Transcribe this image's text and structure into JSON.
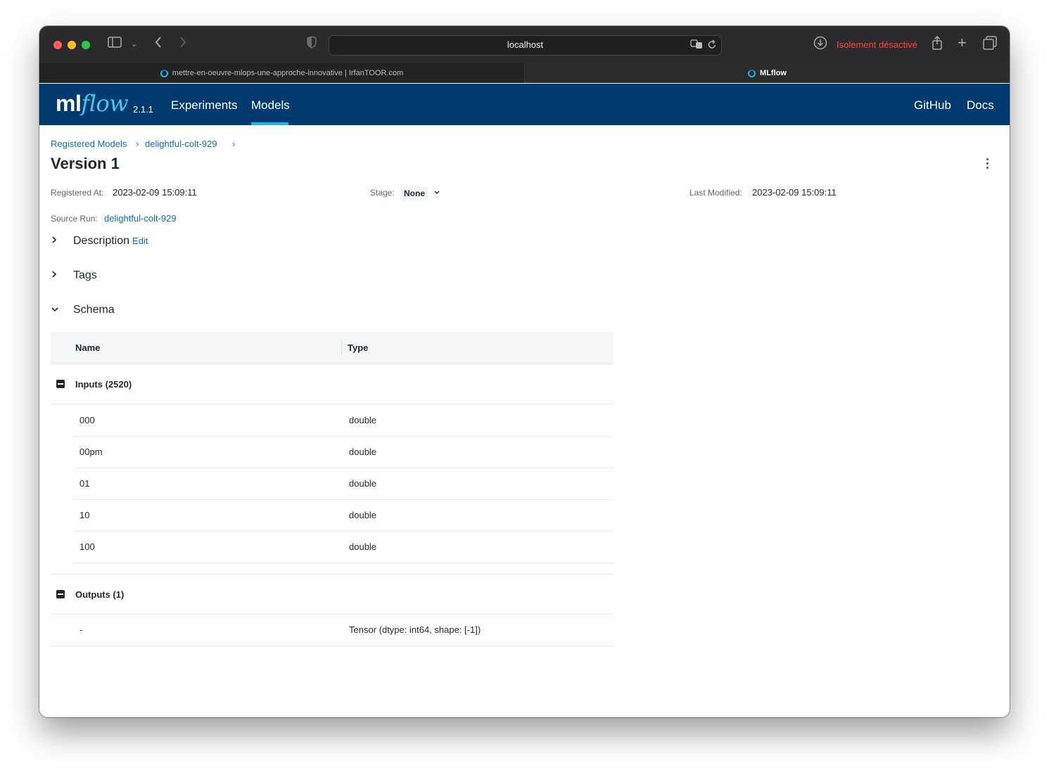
{
  "browser": {
    "address": "localhost",
    "isolation_status": "Isolement désactivé",
    "tabs": [
      {
        "label": "mettre-en-oeuvre-mlops-une-approche-innovative | IrfanTOOR.com"
      },
      {
        "label": "MLflow"
      }
    ]
  },
  "nav": {
    "logo_ml": "ml",
    "logo_flow": "flow",
    "version": "2.1.1",
    "items": [
      {
        "label": "Experiments"
      },
      {
        "label": "Models"
      }
    ],
    "right_items": [
      {
        "label": "GitHub"
      },
      {
        "label": "Docs"
      }
    ]
  },
  "breadcrumb": {
    "items": [
      {
        "label": "Registered Models"
      },
      {
        "label": "delightful-colt-929"
      }
    ],
    "separator": "›"
  },
  "page": {
    "title": "Version 1"
  },
  "meta": {
    "registered_at_label": "Registered At:",
    "registered_at_value": "2023-02-09 15:09:11",
    "stage_label": "Stage:",
    "stage_value": "None",
    "last_modified_label": "Last Modified:",
    "last_modified_value": "2023-02-09 15:09:11",
    "source_run_label": "Source Run:",
    "source_run_value": "delightful-colt-929"
  },
  "sections": {
    "description": {
      "label": "Description",
      "edit_label": "Edit",
      "expanded": false
    },
    "tags": {
      "label": "Tags",
      "expanded": false
    },
    "schema": {
      "label": "Schema",
      "expanded": true
    }
  },
  "schema": {
    "headers": {
      "name": "Name",
      "type": "Type"
    },
    "inputs_label": "Inputs (2520)",
    "inputs": [
      {
        "name": "000",
        "type": "double"
      },
      {
        "name": "00pm",
        "type": "double"
      },
      {
        "name": "01",
        "type": "double"
      },
      {
        "name": "10",
        "type": "double"
      },
      {
        "name": "100",
        "type": "double"
      }
    ],
    "outputs_label": "Outputs (1)",
    "outputs": [
      {
        "name": "-",
        "type": "Tensor (dtype: int64, shape: [-1])"
      }
    ]
  },
  "colors": {
    "nav_bg": "#003a70",
    "link": "#0f6db8",
    "accent": "#1fb8e6",
    "isolation_text": "#ff453a"
  }
}
